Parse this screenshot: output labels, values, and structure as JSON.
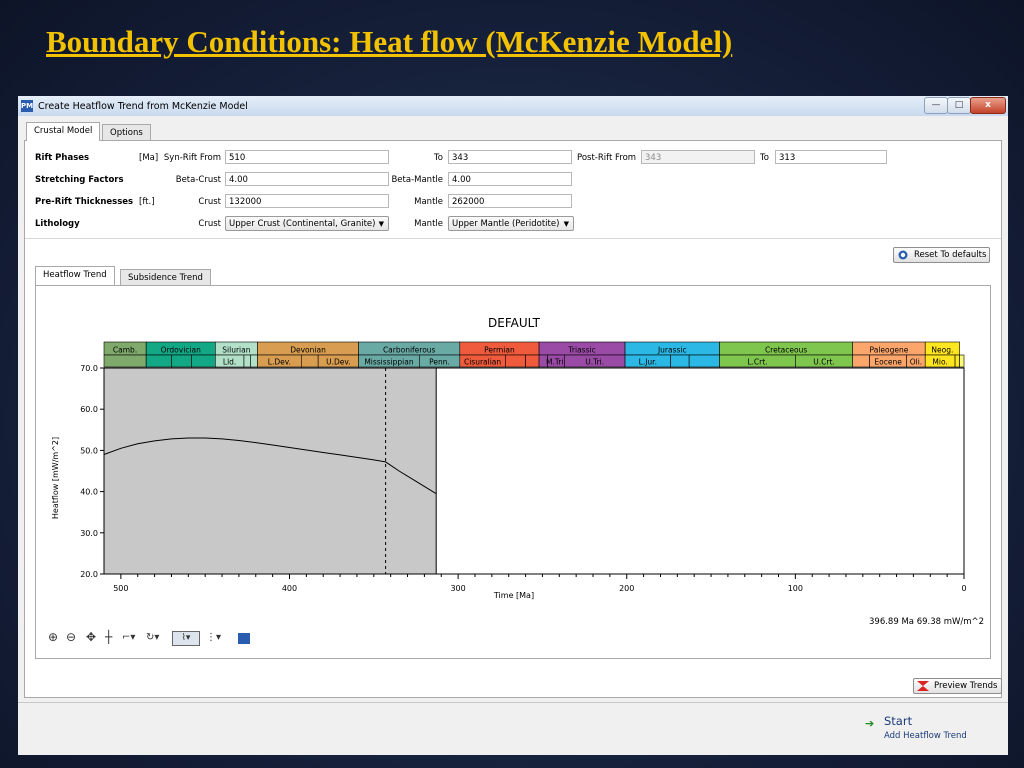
{
  "slide": {
    "title": "Boundary Conditions: Heat flow (McKenzie Model)"
  },
  "window": {
    "title": "Create Heatflow Trend from McKenzie Model",
    "app_icon": "PM",
    "min": "—",
    "max": "□",
    "close": "x"
  },
  "tabs": {
    "crustal_model": "Crustal Model",
    "options": "Options"
  },
  "form": {
    "rift_phases": {
      "label": "Rift Phases",
      "unit": "[Ma]",
      "syn_from_label": "Syn-Rift From",
      "syn_from": "510",
      "to_label": "To",
      "to": "343",
      "post_from_label": "Post-Rift From",
      "post_from": "343",
      "post_to_label": "To",
      "post_to": "313"
    },
    "stretching": {
      "label": "Stretching Factors",
      "beta_crust_label": "Beta-Crust",
      "beta_crust": "4.00",
      "beta_mantle_label": "Beta-Mantle",
      "beta_mantle": "4.00"
    },
    "thickness": {
      "label": "Pre-Rift Thicknesses",
      "unit": "[ft.]",
      "crust_label": "Crust",
      "crust": "132000",
      "mantle_label": "Mantle",
      "mantle": "262000"
    },
    "lithology": {
      "label": "Lithology",
      "crust_label": "Crust",
      "crust": "Upper Crust (Continental, Granite)",
      "mantle_label": "Mantle",
      "mantle": "Upper Mantle (Peridotite)"
    }
  },
  "reset_label": "Reset To defaults",
  "subtabs": {
    "heatflow": "Heatflow Trend",
    "subsidence": "Subsidence Trend"
  },
  "chart_data": {
    "type": "line",
    "title": "DEFAULT",
    "xlabel": "Time [Ma]",
    "ylabel": "Heatflow [mW/m^2]",
    "xlim": [
      510,
      0
    ],
    "ylim": [
      20,
      70
    ],
    "xticks": [
      500,
      400,
      300,
      200,
      100,
      0
    ],
    "yticks": [
      20.0,
      30.0,
      40.0,
      50.0,
      60.0,
      70.0
    ],
    "shaded_range": [
      510,
      313
    ],
    "dashed_marker": 343,
    "series": [
      {
        "x": [
          510,
          500,
          490,
          480,
          470,
          460,
          450,
          440,
          430,
          420,
          410,
          400,
          390,
          380,
          370,
          360,
          350,
          343,
          335,
          325,
          313
        ],
        "y": [
          49.0,
          50.5,
          51.6,
          52.3,
          52.8,
          53.0,
          53.0,
          52.8,
          52.4,
          51.9,
          51.3,
          50.7,
          50.1,
          49.5,
          48.9,
          48.3,
          47.7,
          47.2,
          45.0,
          42.5,
          39.5
        ]
      }
    ],
    "periods": [
      {
        "name": "Camb.",
        "from": 510,
        "to": 485,
        "color": "#7faa6b"
      },
      {
        "name": "Ordovician",
        "from": 485,
        "to": 444,
        "color": "#13a885"
      },
      {
        "name": "Silurian",
        "from": 444,
        "to": 419,
        "color": "#b2e0c8"
      },
      {
        "name": "Devonian",
        "from": 419,
        "to": 359,
        "color": "#d89d50"
      },
      {
        "name": "Carboniferous",
        "from": 359,
        "to": 299,
        "color": "#6aaaa5"
      },
      {
        "name": "Permian",
        "from": 299,
        "to": 252,
        "color": "#ef5b3c"
      },
      {
        "name": "Triassic",
        "from": 252,
        "to": 201,
        "color": "#9a4ba5"
      },
      {
        "name": "Jurassic",
        "from": 201,
        "to": 145,
        "color": "#2bb8e5"
      },
      {
        "name": "Cretaceous",
        "from": 145,
        "to": 66,
        "color": "#7fc64e"
      },
      {
        "name": "Paleogene",
        "from": 66,
        "to": 23,
        "color": "#fda66c"
      },
      {
        "name": "Neog.",
        "from": 23,
        "to": 2.6,
        "color": "#ffe621"
      }
    ],
    "subperiods": [
      {
        "name": "",
        "from": 510,
        "to": 485,
        "color": "#7faa6b"
      },
      {
        "name": "",
        "from": 485,
        "to": 470,
        "color": "#13a885"
      },
      {
        "name": "",
        "from": 470,
        "to": 458,
        "color": "#13a885"
      },
      {
        "name": "",
        "from": 458,
        "to": 444,
        "color": "#13a885"
      },
      {
        "name": "Lld.",
        "from": 444,
        "to": 427,
        "color": "#b2e0c8"
      },
      {
        "name": "",
        "from": 427,
        "to": 423,
        "color": "#b2e0c8"
      },
      {
        "name": "",
        "from": 423,
        "to": 419,
        "color": "#b2e0c8"
      },
      {
        "name": "L.Dev.",
        "from": 419,
        "to": 393,
        "color": "#d89d50"
      },
      {
        "name": "",
        "from": 393,
        "to": 383,
        "color": "#d89d50"
      },
      {
        "name": "U.Dev.",
        "from": 383,
        "to": 359,
        "color": "#d89d50"
      },
      {
        "name": "Mississippian",
        "from": 359,
        "to": 323,
        "color": "#6aaaa5"
      },
      {
        "name": "Penn.",
        "from": 323,
        "to": 299,
        "color": "#6aaaa5"
      },
      {
        "name": "Cisuralian",
        "from": 299,
        "to": 272,
        "color": "#ef5b3c"
      },
      {
        "name": "",
        "from": 272,
        "to": 260,
        "color": "#ef5b3c"
      },
      {
        "name": "",
        "from": 260,
        "to": 252,
        "color": "#ef5b3c"
      },
      {
        "name": "",
        "from": 252,
        "to": 247,
        "color": "#9a4ba5"
      },
      {
        "name": "M.Tri.",
        "from": 247,
        "to": 237,
        "color": "#9a4ba5"
      },
      {
        "name": "U.Tri.",
        "from": 237,
        "to": 201,
        "color": "#9a4ba5"
      },
      {
        "name": "L.Jur.",
        "from": 201,
        "to": 174,
        "color": "#2bb8e5"
      },
      {
        "name": "",
        "from": 174,
        "to": 163,
        "color": "#2bb8e5"
      },
      {
        "name": "",
        "from": 163,
        "to": 145,
        "color": "#2bb8e5"
      },
      {
        "name": "L.Crt.",
        "from": 145,
        "to": 100,
        "color": "#7fc64e"
      },
      {
        "name": "U.Crt.",
        "from": 100,
        "to": 66,
        "color": "#7fc64e"
      },
      {
        "name": "",
        "from": 66,
        "to": 56,
        "color": "#fda66c"
      },
      {
        "name": "Eocene",
        "from": 56,
        "to": 34,
        "color": "#fda66c"
      },
      {
        "name": "Oli.",
        "from": 34,
        "to": 23,
        "color": "#fda66c"
      },
      {
        "name": "Mio.",
        "from": 23,
        "to": 5.3,
        "color": "#ffe621"
      },
      {
        "name": "",
        "from": 5.3,
        "to": 2.6,
        "color": "#ffe621"
      },
      {
        "name": "",
        "from": 2.6,
        "to": 0,
        "color": "#f9f97f"
      }
    ]
  },
  "cursor_readout": "396.89 Ma  69.38 mW/m^2",
  "toolbar": {
    "icons": [
      "zoom-in-icon",
      "zoom-out-icon",
      "pan-icon",
      "crosshair-icon",
      "annotate-icon",
      "clear-icon",
      "line-style-icon",
      "grid-icon",
      "app-icon"
    ]
  },
  "preview_label": "Preview Trends",
  "start": {
    "label": "Start",
    "sub": "Add Heatflow Trend"
  }
}
